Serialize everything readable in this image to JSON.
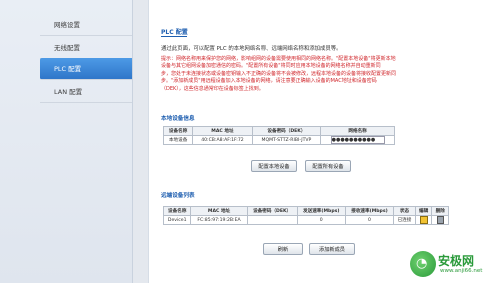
{
  "sidebar": {
    "items": [
      {
        "label": "网络设置"
      },
      {
        "label": "无线配置"
      },
      {
        "label": "PLC 配置"
      },
      {
        "label": "LAN 配置"
      }
    ]
  },
  "main": {
    "title": "PLC 配置",
    "intro": "通过此页面，可以配置 PLC 的本地网络名称、远端网络名称和添加成员等。",
    "hint_lines": [
      "提示：网络名称用来保护您的网络，影响组网的设备需要使用相同的网络名称。\"配置本地设备\"将更新本地",
      "设备与其它组网设备加密通信的密码。\"配置所有设备\"将同时应用本地设备的网络名称并自动重新同",
      "步，您处于未连接状态或设备密钥输入不正确的设备将不会被修改，远程本地设备的设备将接收配置更新同",
      "步。\"添加新成员\"用远程设备加入本地设备的网络，请注意要正确输入设备的MAC地址和设备密码",
      "（DEK），这些信息通常印在设备标签上找到。"
    ],
    "local_section": {
      "title": "本地设备信息",
      "headers": [
        "设备名称",
        "MAC 地址",
        "设备密码（DEK）",
        "网络名称"
      ],
      "row": [
        "本地设备",
        "40:CB:A8:AF:1F:72",
        "MQMT-STTZ-RIBI-JTVP",
        "●●●●●●●●●●"
      ]
    },
    "buttons": {
      "config_local": "配置本地设备",
      "config_all": "配置所有设备"
    },
    "remote_section": {
      "title": "远端设备列表",
      "headers": [
        "设备名称",
        "MAC 地址",
        "设备密码（DEK）",
        "发送速率(Mbps)",
        "接收速率(Mbps)",
        "状态",
        "编辑",
        "删除"
      ],
      "rows": [
        [
          "Device1",
          "FC:85:97:19:2B:EA",
          "",
          "0",
          "0",
          "已连接"
        ]
      ]
    },
    "bottom_buttons": {
      "refresh": "刷新",
      "add_member": "添加新成员"
    }
  },
  "watermark": {
    "text": "安极网",
    "url": "www.anji66.net"
  },
  "colors": {
    "accent": "#1f5fb0",
    "active_sidebar": "#2f76c9",
    "hint": "#d0262b",
    "watermark": "#2a9a3a"
  }
}
